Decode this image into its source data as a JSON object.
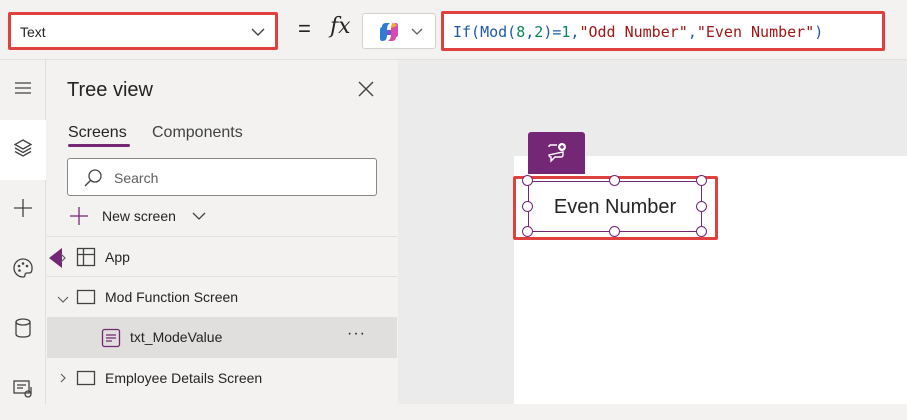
{
  "formula_bar": {
    "property": "Text",
    "equals": "=",
    "fx": "fx",
    "formula_parts": [
      {
        "t": "If(Mod(",
        "c": "fn"
      },
      {
        "t": "8",
        "c": "num"
      },
      {
        "t": ",",
        "c": "fn"
      },
      {
        "t": "2",
        "c": "num"
      },
      {
        "t": ")=",
        "c": "fn"
      },
      {
        "t": "1",
        "c": "num"
      },
      {
        "t": ",",
        "c": "fn"
      },
      {
        "t": "\"Odd Number\"",
        "c": "str"
      },
      {
        "t": ",",
        "c": "fn"
      },
      {
        "t": "\"Even Number\"",
        "c": "str"
      },
      {
        "t": ")",
        "c": "fn"
      }
    ]
  },
  "left_rail": {
    "items": [
      {
        "icon": "hamburger-menu-icon",
        "active": false
      },
      {
        "icon": "layers-icon",
        "active": true
      },
      {
        "icon": "plus-icon",
        "active": false
      },
      {
        "icon": "palette-icon",
        "active": false
      },
      {
        "icon": "database-icon",
        "active": false
      },
      {
        "icon": "media-icon",
        "active": false
      }
    ]
  },
  "tree_view": {
    "title": "Tree view",
    "tabs": [
      {
        "label": "Screens",
        "active": true
      },
      {
        "label": "Components",
        "active": false
      }
    ],
    "search_placeholder": "Search",
    "new_screen_label": "New screen",
    "rows": [
      {
        "label": "App"
      },
      {
        "label": "Mod Function Screen"
      },
      {
        "label": "txt_ModeValue",
        "more": "···"
      },
      {
        "label": "Employee Details Screen"
      }
    ]
  },
  "canvas": {
    "label_text": "Even Number"
  },
  "colors": {
    "accent": "#742774",
    "highlight": "#e0413e"
  }
}
